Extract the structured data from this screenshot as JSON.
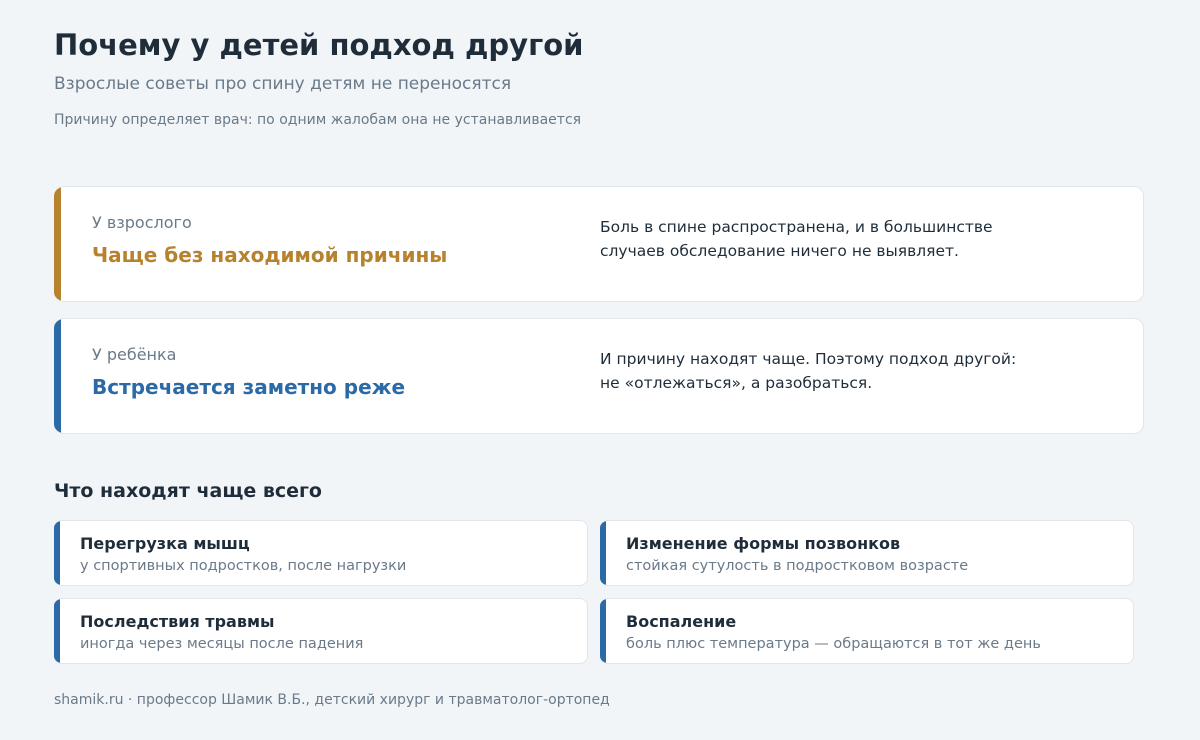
{
  "header": {
    "title": "Почему у детей подход другой",
    "subtitle": "Взрослые советы про спину детям не переносятся",
    "note": "Причину определяет врач: по одним жалобам она не устанавливается"
  },
  "comparison": [
    {
      "label": "У взрослого",
      "headline": "Чаще без находимой причины",
      "description": "Боль в спине распространена, и в большинстве случаев обследование ничего не выявляет.",
      "accent_color": "#b7822d"
    },
    {
      "label": "У ребёнка",
      "headline": "Встречается заметно реже",
      "description": "И причину находят чаще. Поэтому подход другой: не «отлежаться», а разобраться.",
      "accent_color": "#2b6aa6"
    }
  ],
  "findings": {
    "title": "Что находят чаще всего",
    "items": [
      {
        "title": "Перегрузка мышц",
        "description": "у спортивных подростков, после нагрузки"
      },
      {
        "title": "Изменение формы позвонков",
        "description": "стойкая сутулость в подростковом возрасте"
      },
      {
        "title": "Последствия травмы",
        "description": "иногда через месяцы после падения"
      },
      {
        "title": "Воспаление",
        "description": "боль плюс температура — обращаются в тот же день"
      }
    ]
  },
  "footer": {
    "text": "shamik.ru · профессор Шамик В.Б., детский хирург и травматолог-ортопед"
  }
}
